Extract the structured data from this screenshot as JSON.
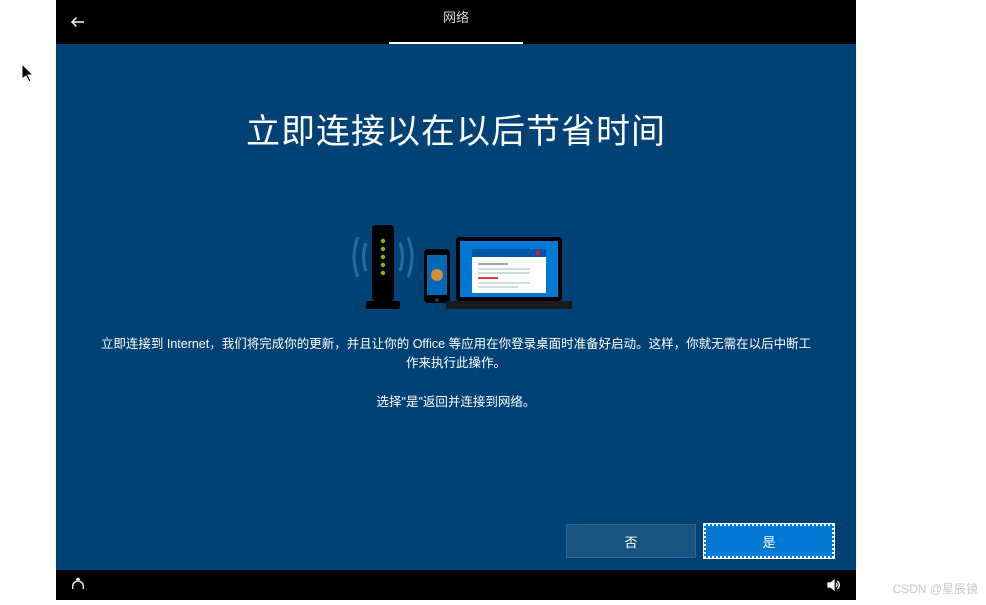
{
  "titlebar": {
    "tab_label": "网络"
  },
  "main": {
    "heading": "立即连接以在以后节省时间",
    "description_line1": "立即连接到 Internet，我们将完成你的更新，并且让你的 Office 等应用在你登录桌面时准备好启动。这样，你就无需在以后中断工作来执行此操作。",
    "description_line2": "选择\"是\"返回并连接到网络。"
  },
  "buttons": {
    "no_label": "否",
    "yes_label": "是"
  },
  "watermark": "CSDN @星辰镜"
}
